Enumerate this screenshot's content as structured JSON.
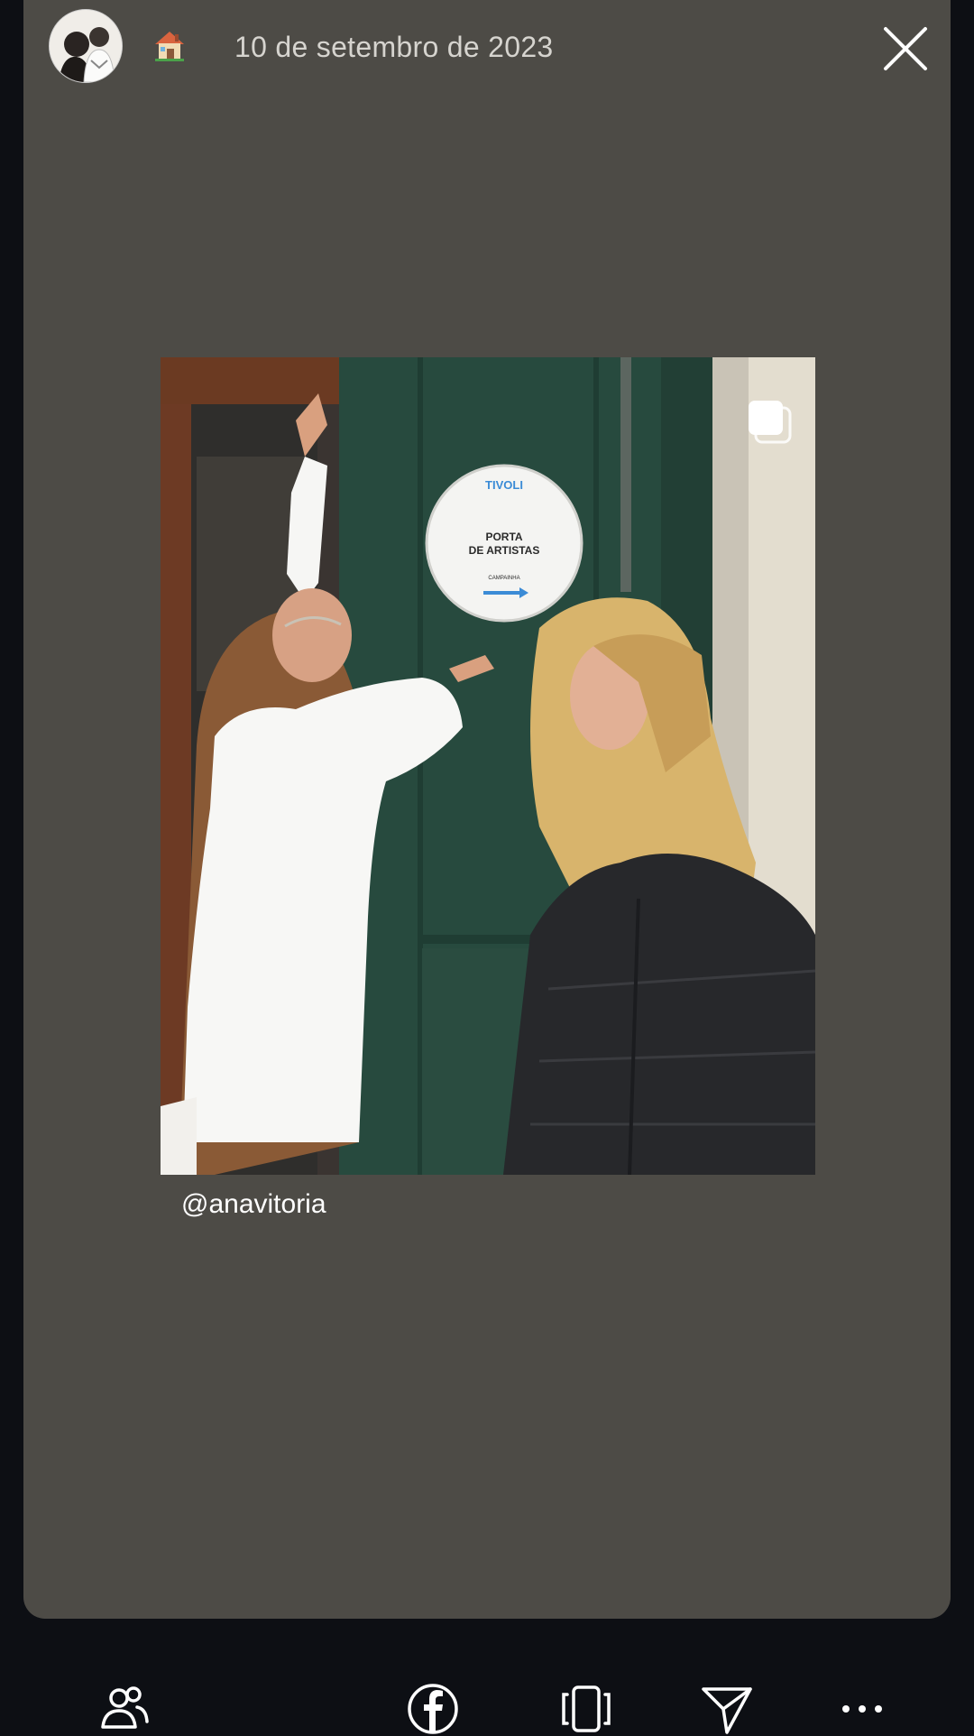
{
  "header": {
    "avatar_icon": "profile-avatar",
    "house_icon": "house-emoji",
    "date": "10 de setembro de 2023",
    "close_icon": "close-icon"
  },
  "post": {
    "sign": {
      "brand": "TIVOLI",
      "line1": "PORTA",
      "line2": "DE ARTISTAS",
      "line3": "CAMPAINHA"
    },
    "carousel_icon": "multiple-photos-icon",
    "mention": "@anavitoria"
  },
  "bottom_bar": {
    "items": [
      {
        "icon": "people-icon"
      },
      {
        "icon": "facebook-icon"
      },
      {
        "icon": "frame-icon"
      },
      {
        "icon": "send-icon"
      },
      {
        "icon": "more-icon"
      }
    ]
  },
  "colors": {
    "page_bg": "#0d0f14",
    "card_bg": "#4d4b46",
    "date_text": "#d6d4cf",
    "door_green": "#274a3e"
  }
}
